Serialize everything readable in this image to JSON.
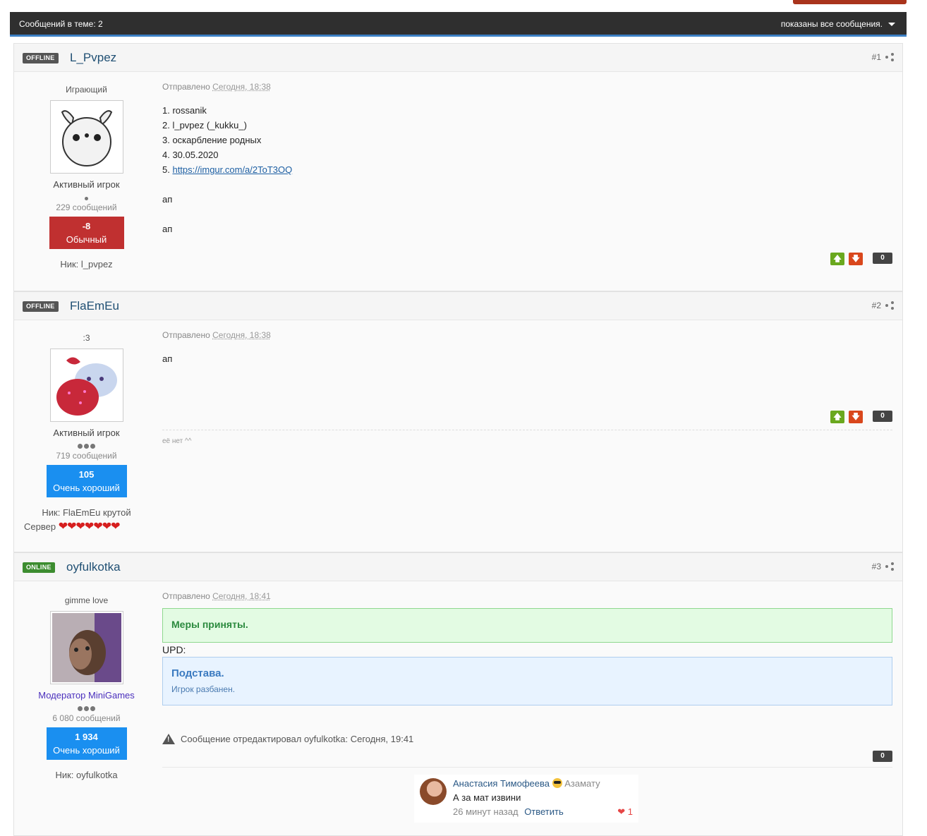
{
  "topbar": {
    "count_label": "Сообщений в теме: 2",
    "filter_label": "показаны все сообщения."
  },
  "posts": [
    {
      "status": "OFFLINE",
      "username": "L_Pvpez",
      "number": "#1",
      "user_title": "Играющий",
      "rank": "Активный игрок",
      "post_count": "229 сообщений",
      "rep_value": "-8",
      "rep_label": "Обычный",
      "nick": "Ник: l_pvpez",
      "posted_prefix": "Отправлено",
      "posted_time": "Сегодня, 18:38",
      "lines": [
        "1. rossanik",
        "2. l_pvpez (_kukku_)",
        "3. оскарбление родных",
        "4. 30.05.2020"
      ],
      "link_prefix": "5. ",
      "link": "https://imgur.com/a/2ToT3OQ",
      "extra": [
        "ап",
        "ап"
      ],
      "vote_count": "0"
    },
    {
      "status": "OFFLINE",
      "username": "FlaEmEu",
      "number": "#2",
      "user_title": ":3",
      "rank": "Активный игрок",
      "post_count": "719 сообщений",
      "rep_value": "105",
      "rep_label": "Очень хороший",
      "nick": "Ник: FlaEmEu крутой",
      "server_label": "Сервер",
      "hearts": "❤❤❤❤❤❤❤",
      "posted_prefix": "Отправлено",
      "posted_time": "Сегодня, 18:38",
      "text": "ап",
      "vote_count": "0",
      "signature": "её нет ^^"
    },
    {
      "status": "ONLINE",
      "username": "oyfulkotka",
      "number": "#3",
      "user_title": "gimme love",
      "rank": "Модератор MiniGames",
      "post_count": "6 080 сообщений",
      "rep_value": "1 934",
      "rep_label": "Очень хороший",
      "nick": "Ник: oyfulkotka",
      "posted_prefix": "Отправлено",
      "posted_time": "Сегодня, 18:41",
      "green_box": "Меры приняты.",
      "upd": "UPD:",
      "blue_title": "Подстава.",
      "blue_sub": "Игрок разбанен.",
      "edited": "Сообщение отредактировал oyfulkotka: Сегодня, 19:41",
      "vote_count": "0"
    }
  ],
  "comment": {
    "author": "Анастасия Тимофеева",
    "to": "Азамату",
    "text": "А за мат извини",
    "time": "26 минут назад",
    "reply": "Ответить",
    "likes": "1"
  },
  "colors": {
    "rep_red": "#c03030",
    "rep_blue": "#1a8ff0",
    "online": "#3c8c2f",
    "offline": "#555555"
  }
}
